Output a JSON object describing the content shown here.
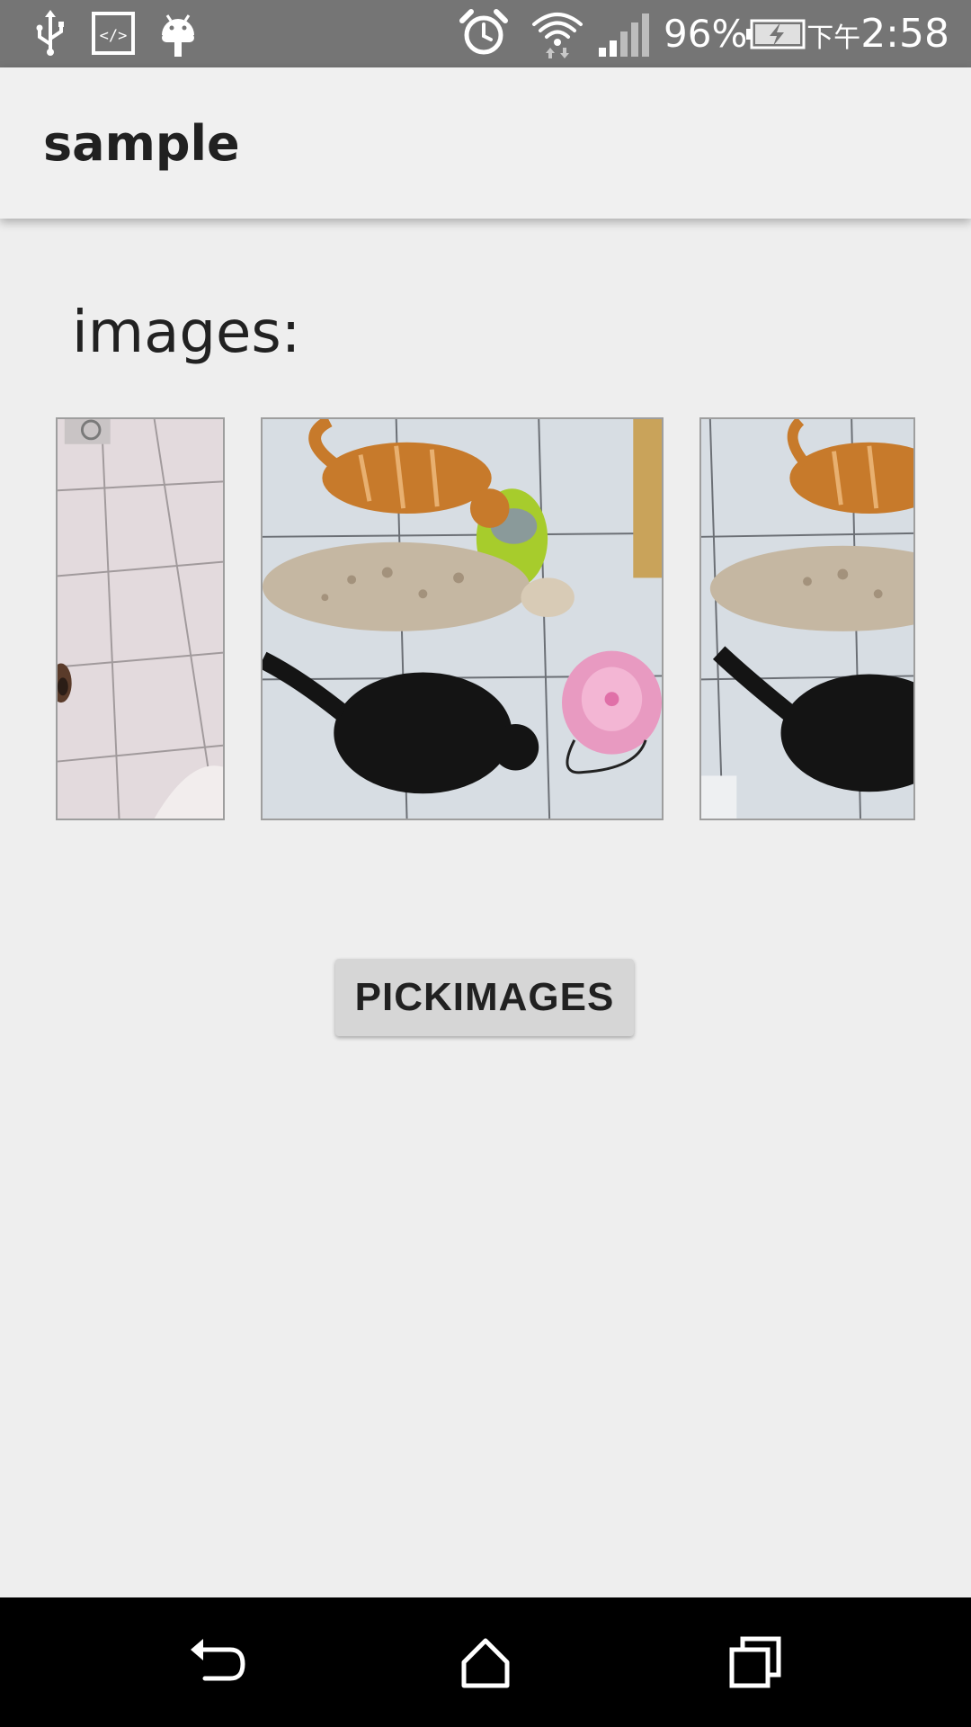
{
  "status_bar": {
    "battery_percent": "96%",
    "time_prefix": "下午",
    "time": "2:58",
    "icons": [
      "usb-icon",
      "dev-icon",
      "android-icon",
      "alarm-icon",
      "wifi-icon",
      "signal-icon",
      "battery-charging-icon"
    ]
  },
  "app_bar": {
    "title": "sample"
  },
  "main": {
    "images_label": "images:",
    "button_label": "PICKIMAGES"
  },
  "nav_bar": {
    "icons": [
      "back-icon",
      "home-icon",
      "recents-icon"
    ]
  }
}
